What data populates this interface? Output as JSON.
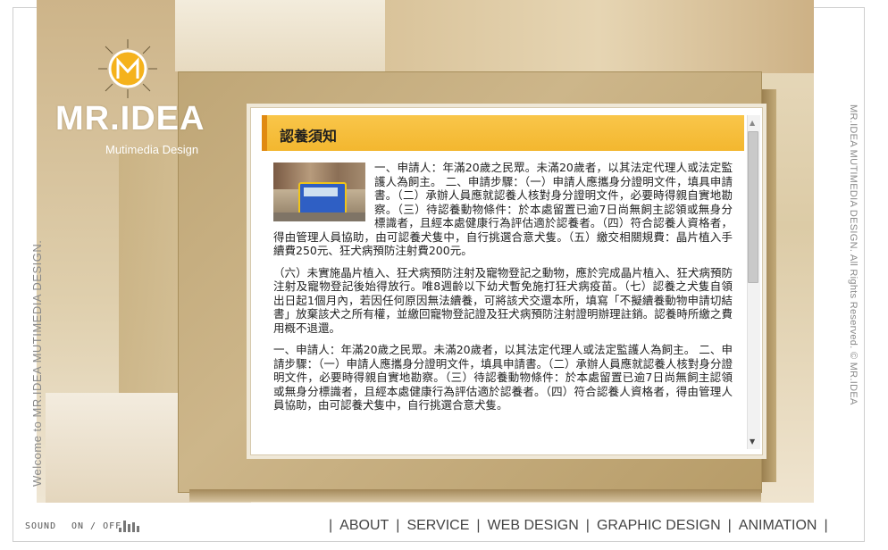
{
  "logo": {
    "title": "MR.IDEA",
    "subtitle": "Mutimedia Design"
  },
  "side_left_text": "Welcome to MR.IDEA MUTIMEDIA DESIGN.",
  "side_right_text": "MR.IDEA MUTIMEDIA DESIGN. All Rights Reserved. © MR.IDEA",
  "panel": {
    "title": "認養須知",
    "paragraphs": [
      "一、申請人：年滿20歲之民眾。未滿20歲者，以其法定代理人或法定監護人為飼主。 二、申請步驟：（一）申請人應攜身分證明文件，填具申請書。（二）承辦人員應就認養人核對身分證明文件，必要時得親自實地勘察。（三）待認養動物條件：於本處留置已逾7日尚無飼主認領或無身分標識者，且經本處健康行為評估適於認養者。（四）符合認養人資格者，得由管理人員協助，由可認養犬隻中，自行挑選合意犬隻。（五）繳交相關規費：晶片植入手續費250元、狂犬病預防注射費200元。",
      "（六）未實施晶片植入、狂犬病預防注射及寵物登記之動物，應於完成晶片植入、狂犬病預防注射及寵物登記後始得放行。唯8週齡以下幼犬暫免施打狂犬病疫苗。（七）認養之犬隻自領出日起1個月內，若因任何原因無法續養，可將該犬交還本所，填寫「不擬續養動物申請切結書」放棄該犬之所有權，並繳回寵物登記證及狂犬病預防注射證明辦理註銷。認養時所繳之費用概不退還。",
      "一、申請人：年滿20歲之民眾。未滿20歲者，以其法定代理人或法定監護人為飼主。 二、申請步驟：（一）申請人應攜身分證明文件，填具申請書。（二）承辦人員應就認養人核對身分證明文件，必要時得親自實地勘察。（三）待認養動物條件：於本處留置已逾7日尚無飼主認領或無身分標識者，且經本處健康行為評估適於認養者。（四）符合認養人資格者，得由管理人員協助，由可認養犬隻中，自行挑選合意犬隻。"
    ]
  },
  "footer": {
    "sound_label": "SOUND",
    "onoff_label": "ON / OFF",
    "nav": [
      "ABOUT",
      "SERVICE",
      "WEB DESIGN",
      "GRAPHIC DESIGN",
      "ANIMATION"
    ],
    "separator": "|"
  },
  "colors": {
    "accent": "#f6bd3a",
    "accent_edge": "#e08a12",
    "beige": "#d9c59c"
  }
}
